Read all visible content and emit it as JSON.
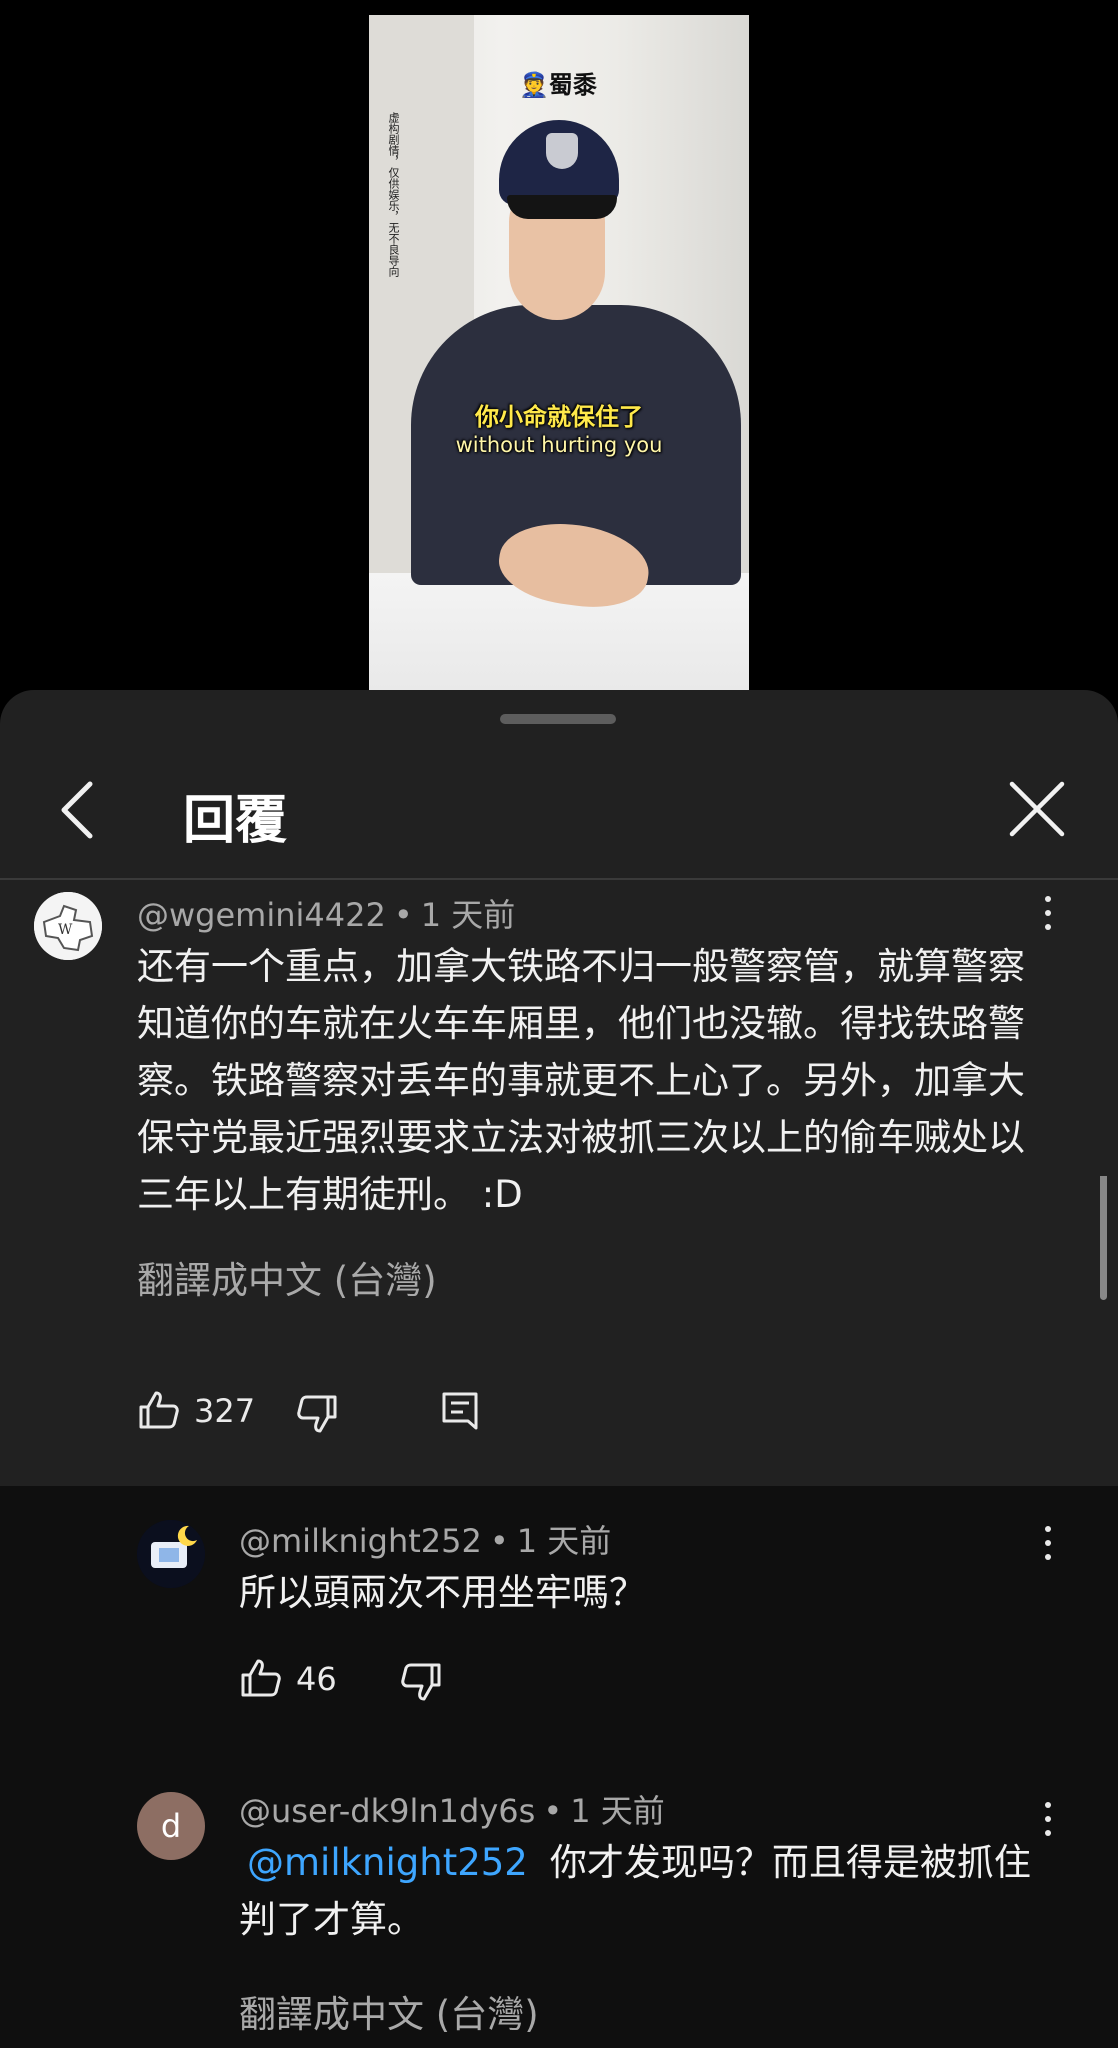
{
  "video": {
    "title": "👮蜀黍",
    "vertical_note": "虚构剧情，仅供娱乐，无不良导向",
    "subtitle_cn": "你小命就保住了",
    "subtitle_en": "without hurting you"
  },
  "sheet": {
    "title": "回覆",
    "icons": {
      "back": "chevron-left-icon",
      "close": "close-icon",
      "more": "more-vert-icon"
    }
  },
  "main_comment": {
    "author": "@wgemini4422",
    "time": "1 天前",
    "text": "还有一个重点，加拿大铁路不归一般警察管，就算警察知道你的车就在火车车厢里，他们也没辙。得找铁路警察。铁路警察对丢车的事就更不上心了。另外，加拿大保守党最近强烈要求立法对被抓三次以上的偷车贼处以三年以上有期徒刑。 :D",
    "translate_label": "翻譯成中文 (台灣)",
    "likes": "327"
  },
  "replies": [
    {
      "author": "@milknight252",
      "time": "1 天前",
      "text": "所以頭兩次不用坐牢嗎？",
      "likes": "46"
    },
    {
      "author": "@user-dk9ln1dy6s",
      "avatar_letter": "d",
      "avatar_color": "#8d6e63",
      "time": "1 天前",
      "mention": "@milknight252",
      "text": "你才发现吗？而且得是被抓住判了才算。",
      "translate_label": "翻譯成中文 (台灣)"
    }
  ],
  "colors": {
    "sheet_bg": "#212121",
    "reply_bg": "#0f0f0f",
    "mention": "#3ea6ff"
  }
}
